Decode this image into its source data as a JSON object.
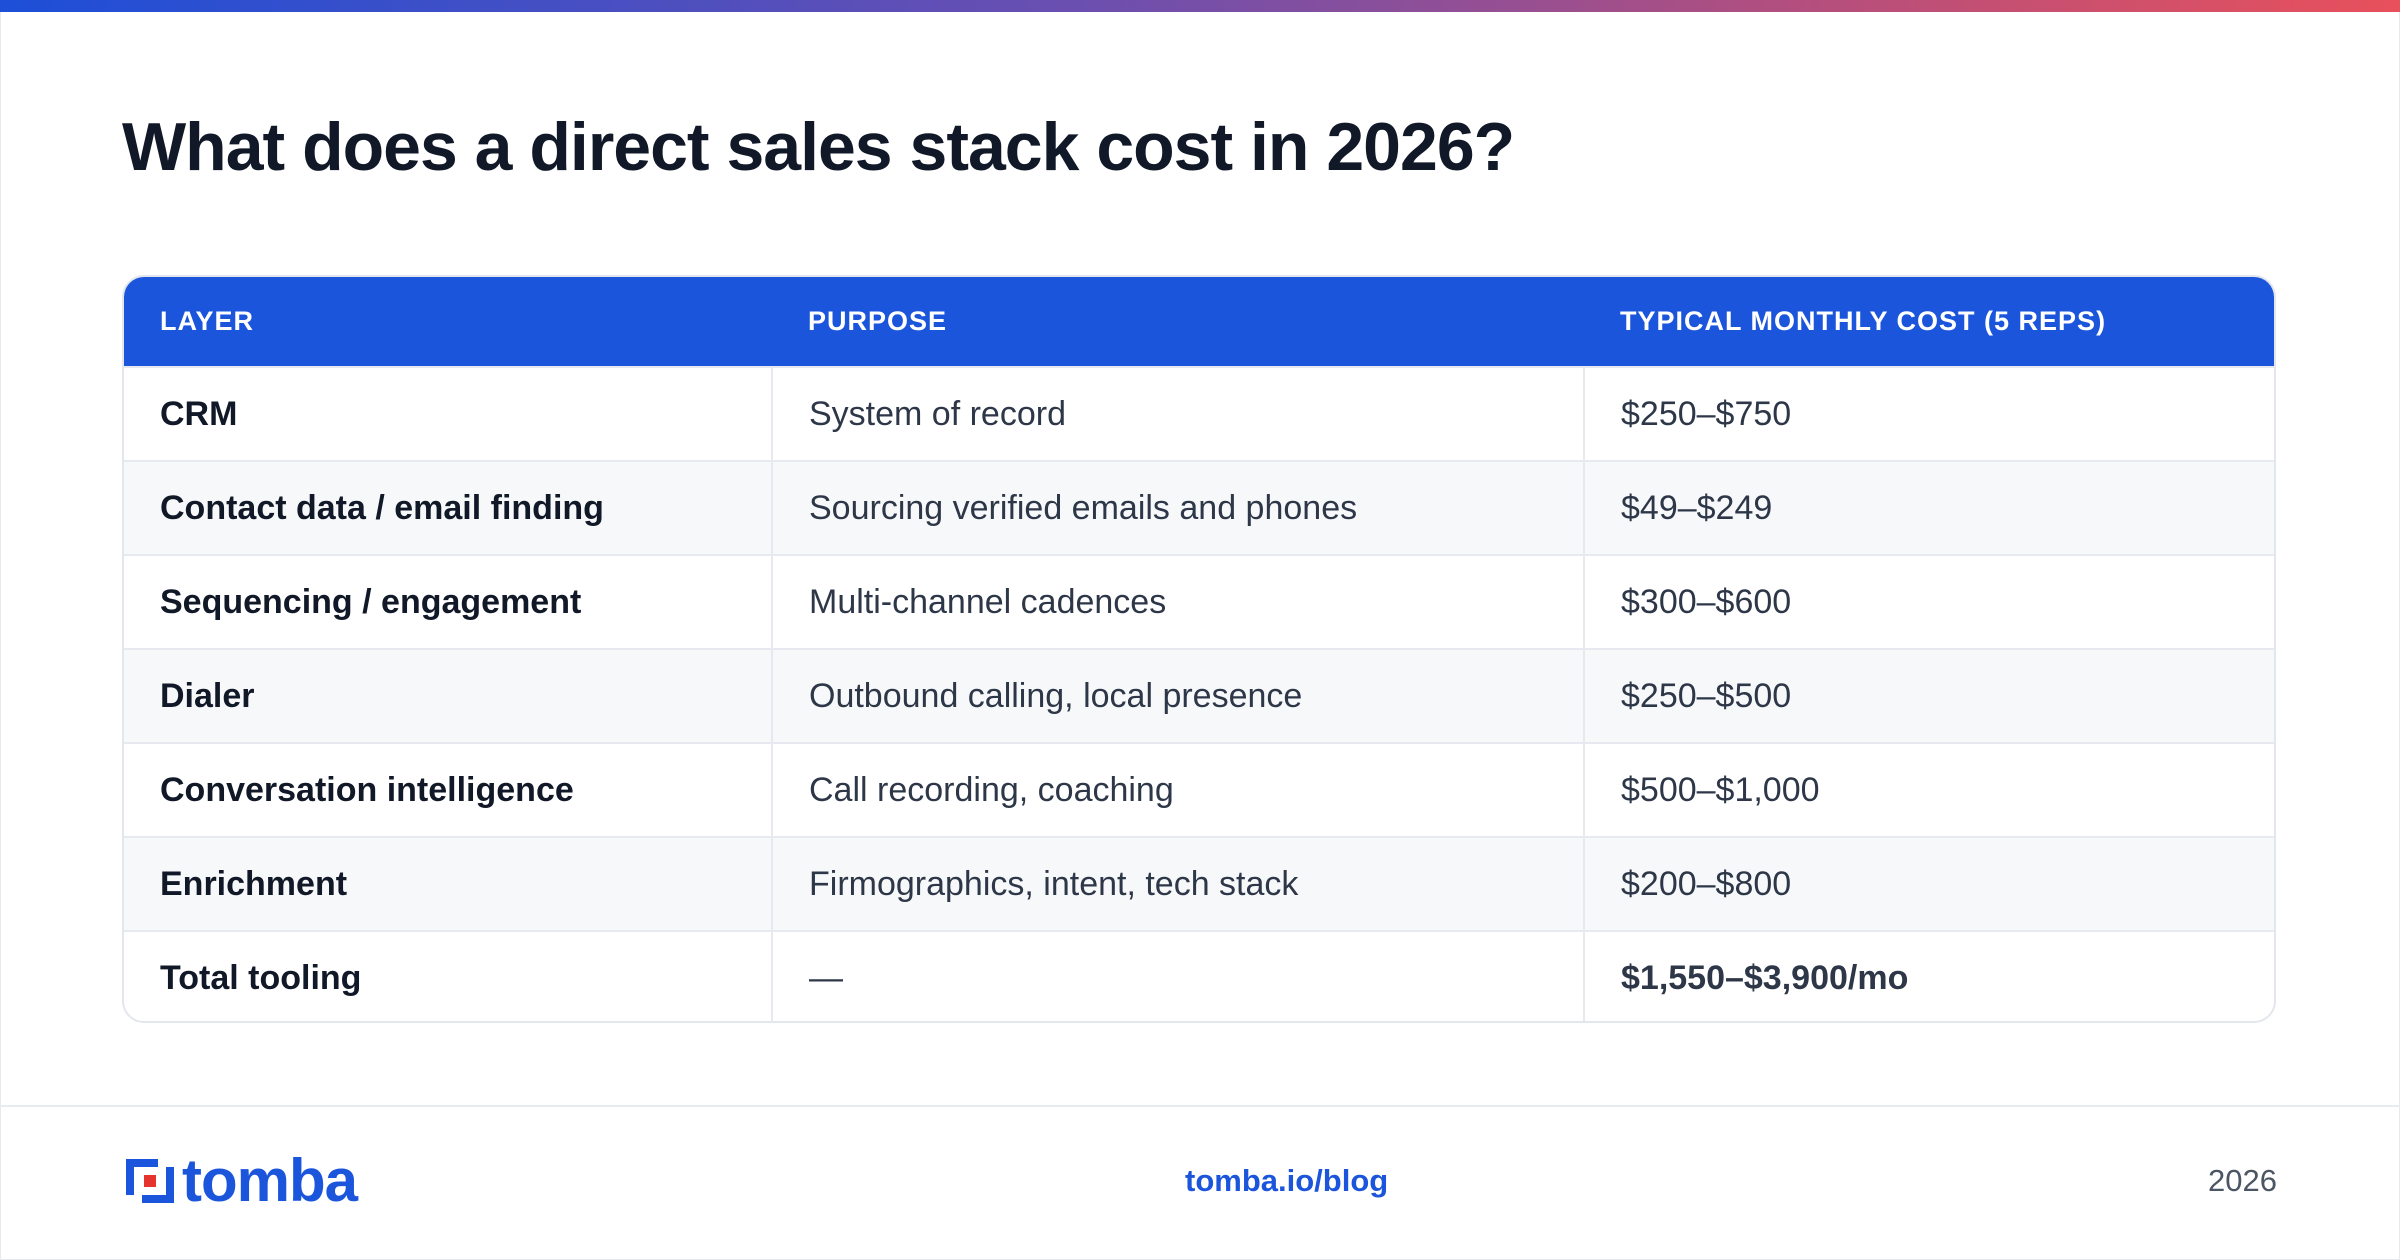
{
  "title": "What does a direct sales stack cost in 2026?",
  "table": {
    "headers": [
      "LAYER",
      "PURPOSE",
      "TYPICAL MONTHLY COST (5 REPS)"
    ],
    "rows": [
      {
        "layer": "CRM",
        "purpose": "System of record",
        "cost": "$250–$750"
      },
      {
        "layer": "Contact data / email finding",
        "purpose": "Sourcing verified emails and phones",
        "cost": "$49–$249"
      },
      {
        "layer": "Sequencing / engagement",
        "purpose": "Multi-channel cadences",
        "cost": "$300–$600"
      },
      {
        "layer": "Dialer",
        "purpose": "Outbound calling, local presence",
        "cost": "$250–$500"
      },
      {
        "layer": "Conversation intelligence",
        "purpose": "Call recording, coaching",
        "cost": "$500–$1,000"
      },
      {
        "layer": "Enrichment",
        "purpose": "Firmographics, intent, tech stack",
        "cost": "$200–$800"
      },
      {
        "layer": "Total tooling",
        "purpose": "—",
        "cost": "$1,550–$3,900/mo"
      }
    ]
  },
  "footer": {
    "logo_text": "tomba",
    "link": "tomba.io/blog",
    "year": "2026"
  },
  "colors": {
    "accent": "#1b55dc",
    "logo_red": "#e5342d",
    "gradient_start": "#1d4fd8",
    "gradient_end": "#e8505b"
  },
  "icons": {
    "logo": "tomba-logo-icon"
  }
}
